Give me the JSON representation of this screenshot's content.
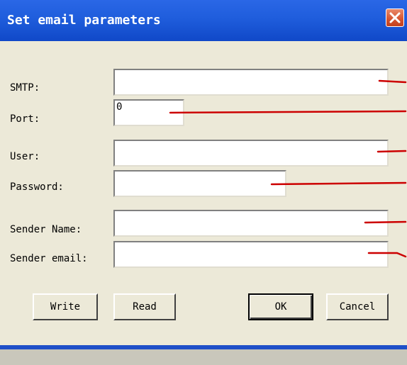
{
  "window": {
    "title": "Set email parameters",
    "close_icon": "close-icon"
  },
  "fields": {
    "smtp": {
      "label": "SMTP:",
      "value": ""
    },
    "port": {
      "label": "Port:",
      "value": "0"
    },
    "user": {
      "label": "User:",
      "value": ""
    },
    "password": {
      "label": "Password:",
      "value": ""
    },
    "sender_name": {
      "label": "Sender Name:",
      "value": ""
    },
    "sender_email": {
      "label": "Sender email:",
      "value": ""
    }
  },
  "buttons": {
    "write": "Write",
    "read": "Read",
    "ok": "OK",
    "cancel": "Cancel"
  },
  "colors": {
    "titlebar": "#1f5ddc",
    "annotation_line": "#cc0000",
    "close_button": "#d5532e"
  }
}
